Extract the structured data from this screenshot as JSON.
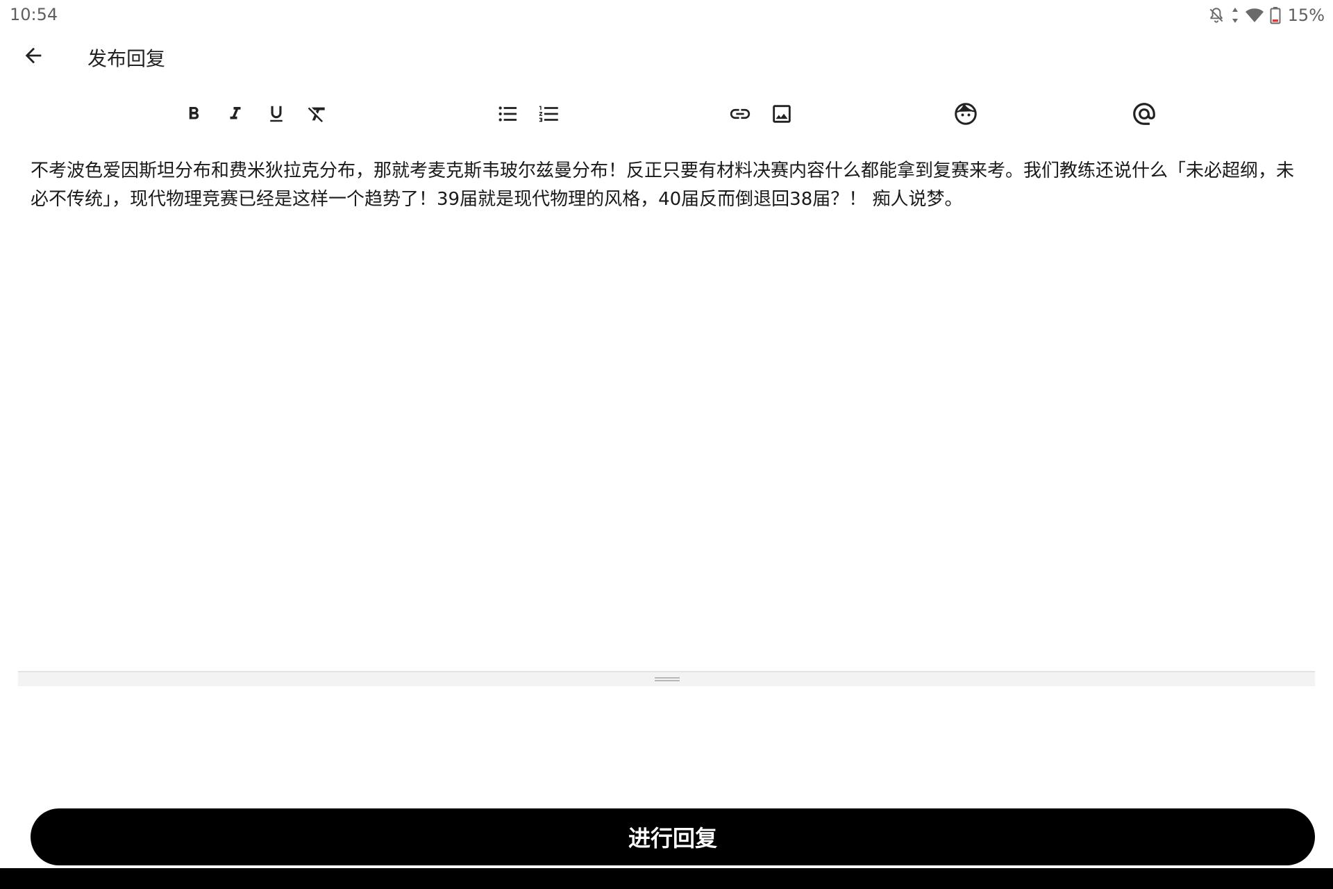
{
  "status_bar": {
    "time": "10:54",
    "battery": "15%",
    "icons": [
      "notifications-off-icon",
      "data-arrows-icon",
      "wifi-icon",
      "battery-low-icon"
    ]
  },
  "app_bar": {
    "back_icon": "arrow-back-icon",
    "title": "发布回复"
  },
  "toolbar": {
    "buttons": [
      {
        "name": "bold",
        "icon": "bold-icon"
      },
      {
        "name": "italic",
        "icon": "italic-icon"
      },
      {
        "name": "underline",
        "icon": "underline-icon"
      },
      {
        "name": "clear-format",
        "icon": "clear-format-icon"
      },
      {
        "name": "bulleted-list",
        "icon": "bulleted-list-icon"
      },
      {
        "name": "numbered-list",
        "icon": "numbered-list-icon"
      },
      {
        "name": "link",
        "icon": "link-icon"
      },
      {
        "name": "image",
        "icon": "image-icon"
      },
      {
        "name": "emoji",
        "icon": "emoji-face-icon"
      },
      {
        "name": "mention",
        "icon": "at-icon"
      }
    ]
  },
  "editor": {
    "content": "不考波色爱因斯坦分布和费米狄拉克分布，那就考麦克斯韦玻尔兹曼分布！反正只要有材料决赛内容什么都能拿到复赛来考。我们教练还说什么「未必超纲，未必不传统」，现代物理竞赛已经是这样一个趋势了！39届就是现代物理的风格，40届反而倒退回38届？！ 痴人说梦。"
  },
  "actions": {
    "submit_label": "进行回复"
  },
  "colors": {
    "accent": "#000000",
    "background": "#ffffff",
    "text": "#1a1a1a",
    "battery_low": "#e53935"
  }
}
